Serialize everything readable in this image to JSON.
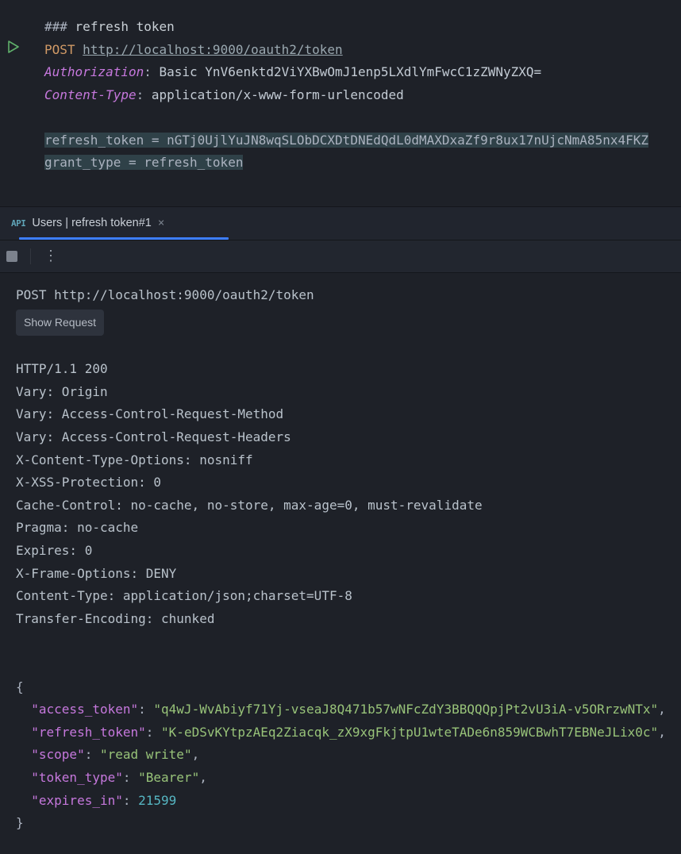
{
  "editor": {
    "comment_prefix": "###",
    "comment": "refresh token",
    "method": "POST",
    "url": "http://localhost:9000/oauth2/token",
    "headers": [
      {
        "name": "Authorization",
        "value": "Basic YnV6enktd2ViYXBwOmJ1enp5LXdlYmFwcC1zZWNyZXQ="
      },
      {
        "name": "Content-Type",
        "value": "application/x-www-form-urlencoded"
      }
    ],
    "body_lines": [
      "refresh_token = nGTj0UjlYuJN8wqSLObDCXDtDNEdQdL0dMAXDxaZf9r8ux17nUjcNmA85nx4FKZ",
      "grant_type = refresh_token"
    ]
  },
  "tab": {
    "label": "Users | refresh token#1"
  },
  "tools": {
    "show_request": "Show Request"
  },
  "response": {
    "request_line": "POST http://localhost:9000/oauth2/token",
    "status": "HTTP/1.1 200",
    "headers": [
      "Vary: Origin",
      "Vary: Access-Control-Request-Method",
      "Vary: Access-Control-Request-Headers",
      "X-Content-Type-Options: nosniff",
      "X-XSS-Protection: 0",
      "Cache-Control: no-cache, no-store, max-age=0, must-revalidate",
      "Pragma: no-cache",
      "Expires: 0",
      "X-Frame-Options: DENY",
      "Content-Type: application/json;charset=UTF-8",
      "Transfer-Encoding: chunked"
    ],
    "json": {
      "access_token": "q4wJ-WvAbiyf71Yj-vseaJ8Q471b57wNFcZdY3BBQQQpjPt2vU3iA-v5ORrzwNTx",
      "refresh_token": "K-eDSvKYtpzAEq2Ziacqk_zX9xgFkjtpU1wteTADe6n859WCBwhT7EBNeJLix0c",
      "scope": "read write",
      "token_type": "Bearer",
      "expires_in": 21599
    }
  }
}
